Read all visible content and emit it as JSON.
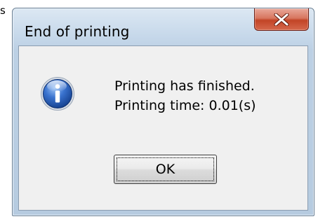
{
  "stray_char": "s",
  "window": {
    "title": "End of printing",
    "close_glyph": "X"
  },
  "message": {
    "line1": "Printing has finished.",
    "line2": "Printing time: 0.01(s)"
  },
  "buttons": {
    "ok_label": "OK"
  },
  "icon": "info-icon",
  "colors": {
    "close_button": "#c24426",
    "icon_blue": "#2a5bb5",
    "client_bg": "#f0f0f0"
  }
}
